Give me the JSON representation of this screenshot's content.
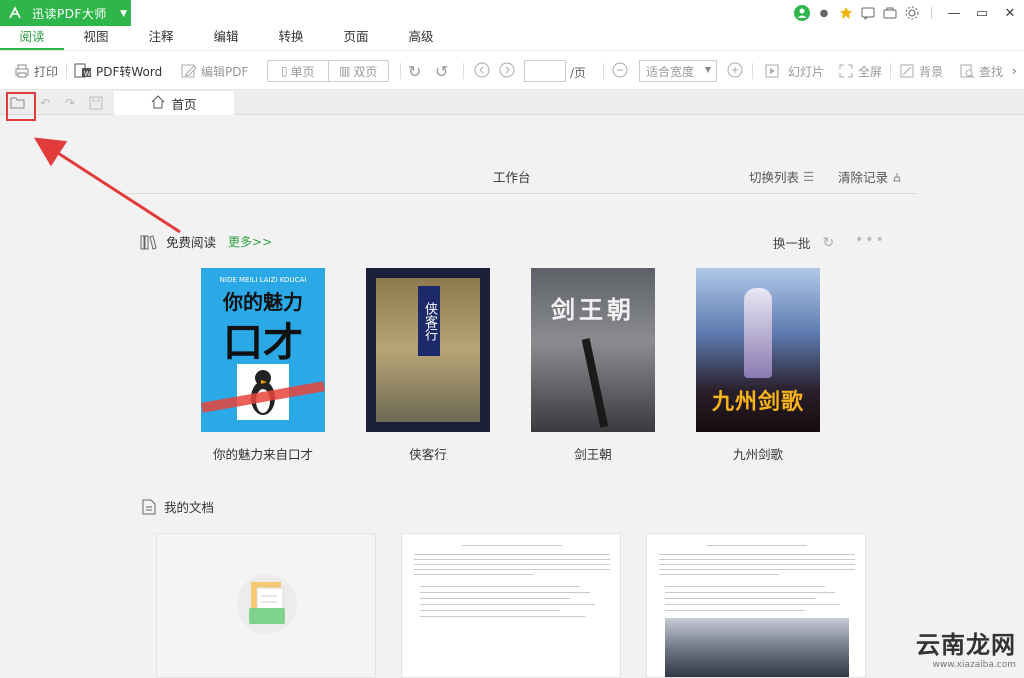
{
  "app": {
    "title": "迅读PDF大师"
  },
  "menu": {
    "tabs": [
      "阅读",
      "视图",
      "注释",
      "编辑",
      "转换",
      "页面",
      "高级"
    ]
  },
  "toolbar": {
    "print": "打印",
    "pdf_to_word": "PDF转Word",
    "edit_pdf": "编辑PDF",
    "single_page": "单页",
    "double_page": "双页",
    "page_value": "",
    "page_unit": "/页",
    "zoom": "适合宽度",
    "slideshow": "幻灯片",
    "fullscreen": "全屏",
    "background": "背景",
    "find": "查找"
  },
  "quickbar": {
    "home_tab": "首页"
  },
  "workbench": {
    "title": "工作台",
    "switch_list": "切换列表",
    "clear_records": "清除记录"
  },
  "free_reading": {
    "title": "免费阅读",
    "more": "更多>>",
    "refresh": "换一批",
    "books": [
      {
        "title": "你的魅力来自口才",
        "cover_top": "NIDE MEILI LAIZI KOUCAI",
        "cover_main": "你的魅力",
        "cover_big": "口才"
      },
      {
        "title": "侠客行",
        "cover_text": "侠客行"
      },
      {
        "title": "剑王朝",
        "cover_text": "剑王朝"
      },
      {
        "title": "九州剑歌",
        "cover_text": "九州剑歌"
      }
    ]
  },
  "my_docs": {
    "title": "我的文档"
  },
  "watermark": {
    "cn": "云南龙网",
    "latin": "www.xiazaiba.com"
  }
}
